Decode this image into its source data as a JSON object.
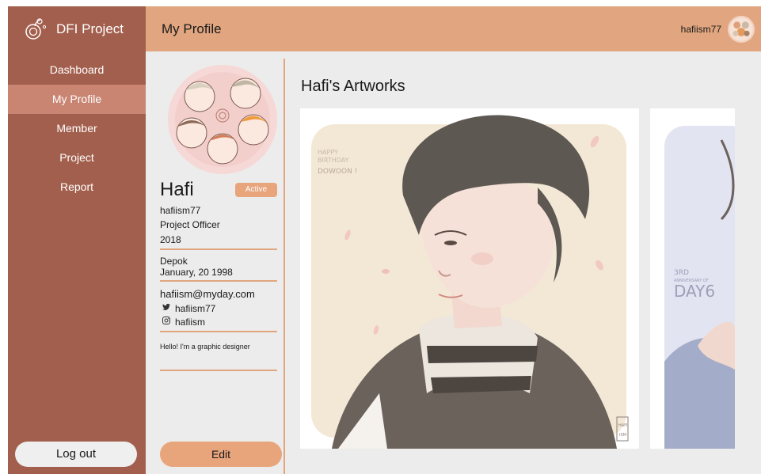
{
  "brand": {
    "name": "DFI Project",
    "logo_icon": "flower-sprout-icon"
  },
  "sidebar": {
    "items": [
      {
        "label": "Dashboard",
        "active": false
      },
      {
        "label": "My Profile",
        "active": true
      },
      {
        "label": "Member",
        "active": false
      },
      {
        "label": "Project",
        "active": false
      },
      {
        "label": "Report",
        "active": false
      }
    ],
    "logout_label": "Log out"
  },
  "header": {
    "title": "My Profile",
    "username": "hafiism77"
  },
  "profile": {
    "name": "Hafi",
    "status": "Active",
    "username": "hafiism77",
    "role": "Project Officer",
    "year": "2018",
    "city": "Depok",
    "birthdate": "January, 20 1998",
    "email": "hafiism@myday.com",
    "twitter": "hafiism77",
    "instagram": "hafiism",
    "bio": "Hello! I'm a graphic designer",
    "edit_label": "Edit"
  },
  "artworks": {
    "title": "Hafi's Artworks",
    "items": [
      {
        "caption_lines": [
          "Happy",
          "Birthday",
          "DOWOON !"
        ],
        "signature": "HAFI ISM"
      },
      {
        "caption_lines": [
          "3rd",
          "Anniversary of",
          "DAY6"
        ]
      }
    ]
  },
  "colors": {
    "sidebar": "#a35f4d",
    "sidebar_active": "#c98572",
    "topbar": "#e1a67f",
    "accent": "#e8a57c",
    "background": "#ececec"
  }
}
